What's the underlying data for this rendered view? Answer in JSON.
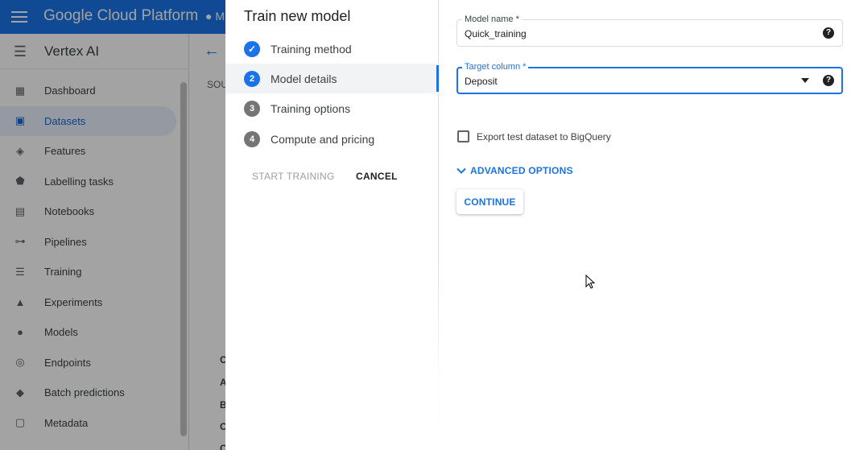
{
  "topbar": {
    "brand": "Google Cloud Platform",
    "project": "● M"
  },
  "sidebar": {
    "product": "Vertex AI",
    "items": [
      {
        "label": "Dashboard",
        "icon": "dashboard-icon",
        "glyph": "▦"
      },
      {
        "label": "Datasets",
        "icon": "datasets-icon",
        "glyph": "▣"
      },
      {
        "label": "Features",
        "icon": "features-icon",
        "glyph": "◈"
      },
      {
        "label": "Labelling tasks",
        "icon": "label-icon",
        "glyph": "⬟"
      },
      {
        "label": "Notebooks",
        "icon": "notebooks-icon",
        "glyph": "▤"
      },
      {
        "label": "Pipelines",
        "icon": "pipelines-icon",
        "glyph": "⊶"
      },
      {
        "label": "Training",
        "icon": "training-icon",
        "glyph": "☰"
      },
      {
        "label": "Experiments",
        "icon": "experiments-icon",
        "glyph": "▲"
      },
      {
        "label": "Models",
        "icon": "models-icon",
        "glyph": "●"
      },
      {
        "label": "Endpoints",
        "icon": "endpoints-icon",
        "glyph": "◎"
      },
      {
        "label": "Batch predictions",
        "icon": "batch-icon",
        "glyph": "◆"
      },
      {
        "label": "Metadata",
        "icon": "metadata-icon",
        "glyph": "▢"
      }
    ]
  },
  "main_bg": {
    "tab_label": "SOU",
    "row_labels": [
      "C",
      "A",
      "B",
      "C",
      "C"
    ]
  },
  "dialog": {
    "title": "Train new model",
    "steps": [
      {
        "num": "✓",
        "label": "Training method"
      },
      {
        "num": "2",
        "label": "Model details"
      },
      {
        "num": "3",
        "label": "Training options"
      },
      {
        "num": "4",
        "label": "Compute and pricing"
      }
    ],
    "start_label": "START TRAINING",
    "cancel_label": "CANCEL"
  },
  "form": {
    "model_name_label": "Model name *",
    "model_name_value": "Quick_training",
    "target_label": "Target column *",
    "target_value": "Deposit",
    "export_label": "Export test dataset to BigQuery",
    "export_checked": false,
    "advanced_label": "ADVANCED OPTIONS",
    "continue_label": "CONTINUE"
  },
  "colors": {
    "accent": "#1a73e8",
    "topbar": "#1a73e8"
  }
}
